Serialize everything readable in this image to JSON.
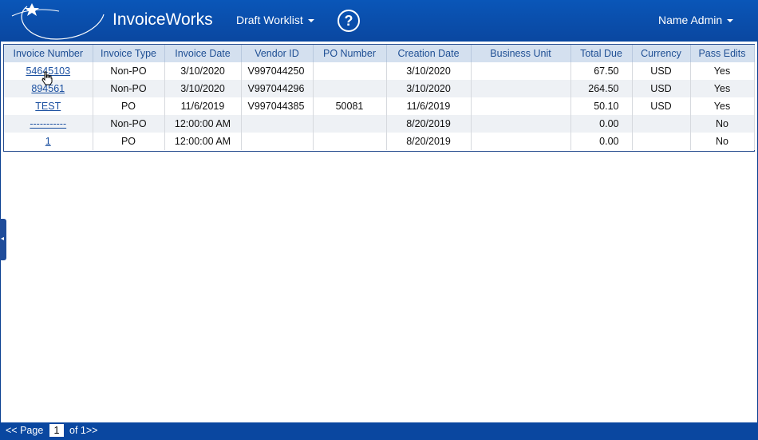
{
  "header": {
    "app_title": "InvoiceWorks",
    "worklist_label": "Draft Worklist",
    "help_glyph": "?",
    "user_label": "Name Admin"
  },
  "table": {
    "columns": [
      "Invoice Number",
      "Invoice Type",
      "Invoice Date",
      "Vendor ID",
      "PO Number",
      "Creation Date",
      "Business Unit",
      "Total Due",
      "Currency",
      "Pass Edits"
    ],
    "rows": [
      {
        "invoice_number": "54645103",
        "invoice_type": "Non-PO",
        "invoice_date": "3/10/2020",
        "vendor_id": "V997044250",
        "po_number": "",
        "creation_date": "3/10/2020",
        "business_unit": "",
        "total_due": "67.50",
        "currency": "USD",
        "pass_edits": "Yes"
      },
      {
        "invoice_number": "894561",
        "invoice_type": "Non-PO",
        "invoice_date": "3/10/2020",
        "vendor_id": "V997044296",
        "po_number": "",
        "creation_date": "3/10/2020",
        "business_unit": "",
        "total_due": "264.50",
        "currency": "USD",
        "pass_edits": "Yes"
      },
      {
        "invoice_number": "TEST",
        "invoice_type": "PO",
        "invoice_date": "11/6/2019",
        "vendor_id": "V997044385",
        "po_number": "50081",
        "creation_date": "11/6/2019",
        "business_unit": "",
        "total_due": "50.10",
        "currency": "USD",
        "pass_edits": "Yes"
      },
      {
        "invoice_number": "-----------",
        "invoice_type": "Non-PO",
        "invoice_date": "12:00:00 AM",
        "vendor_id": "",
        "po_number": "",
        "creation_date": "8/20/2019",
        "business_unit": "",
        "total_due": "0.00",
        "currency": "",
        "pass_edits": "No"
      },
      {
        "invoice_number": "1",
        "invoice_type": "PO",
        "invoice_date": "12:00:00 AM",
        "vendor_id": "",
        "po_number": "",
        "creation_date": "8/20/2019",
        "business_unit": "",
        "total_due": "0.00",
        "currency": "",
        "pass_edits": "No"
      }
    ]
  },
  "footer": {
    "prev_label": "<< Page",
    "current_page": "1",
    "of_label": "of 1>>"
  },
  "colors": {
    "header_bg": "#0a4ea8",
    "grid_header_bg": "#d4e0ef",
    "link": "#1a4fa0"
  }
}
